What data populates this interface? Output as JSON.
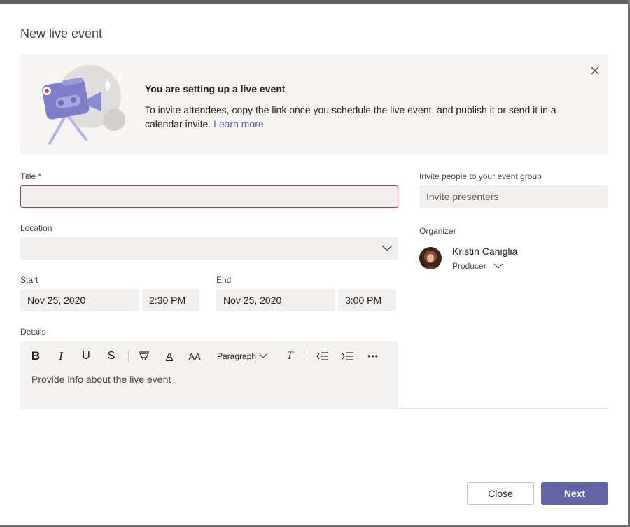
{
  "dialog": {
    "title": "New live event"
  },
  "banner": {
    "heading": "You are setting up a live event",
    "text": "To invite attendees, copy the link once you schedule the live event, and publish it or send it in a calendar invite.",
    "link": "Learn more",
    "illustration_icon": "video-camera-icon",
    "close_icon": "close-icon"
  },
  "form": {
    "title_label": "Title *",
    "title_value": "",
    "location_label": "Location",
    "location_value": "",
    "start_label": "Start",
    "start_date": "Nov 25, 2020",
    "start_time": "2:30 PM",
    "end_label": "End",
    "end_date": "Nov 25, 2020",
    "end_time": "3:00 PM",
    "details_label": "Details",
    "details_placeholder": "Provide info about the live event",
    "paragraph_label": "Paragraph"
  },
  "toolbar": {
    "bold": "B",
    "italic": "I",
    "underline": "U",
    "strike": "S",
    "font_color": "A",
    "font_size": "AA",
    "clear": "T",
    "more": "•••"
  },
  "invite": {
    "label": "Invite people to your event group",
    "placeholder": "Invite presenters"
  },
  "organizer": {
    "label": "Organizer",
    "name": "Kristin Caniglia",
    "role": "Producer"
  },
  "footer": {
    "close_label": "Close",
    "next_label": "Next"
  },
  "colors": {
    "accent": "#6264a7",
    "error_border": "#c4314b"
  }
}
